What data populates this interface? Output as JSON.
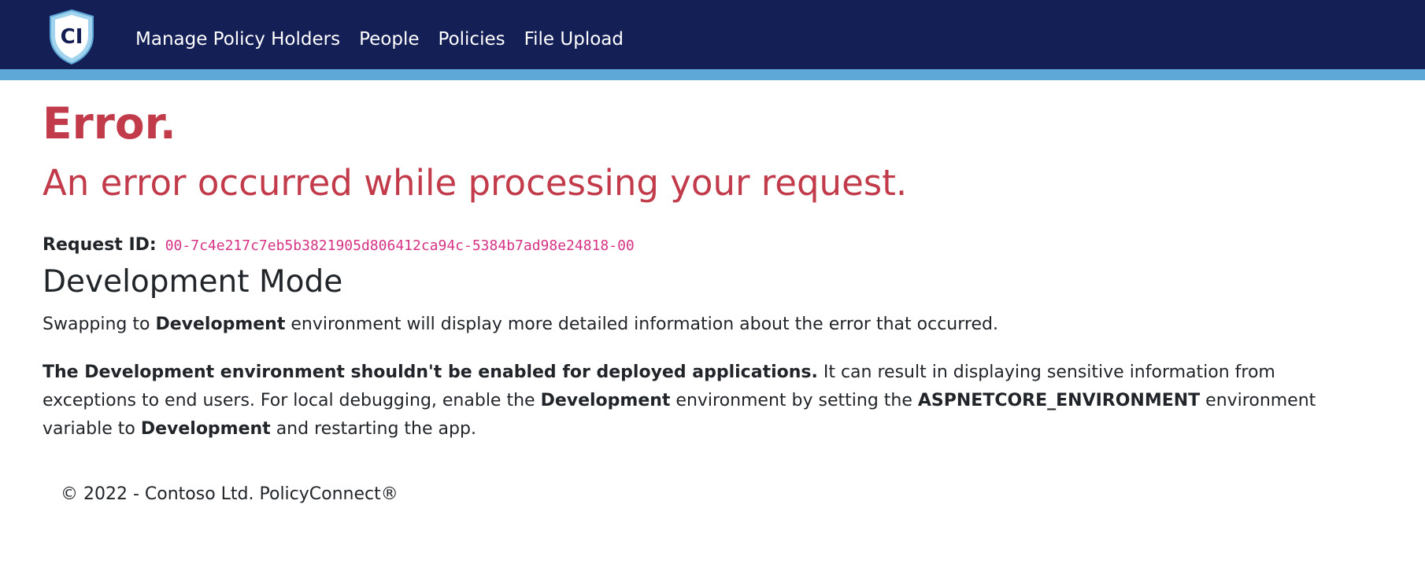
{
  "nav": {
    "logo_text": "CI",
    "links": [
      "Manage Policy Holders",
      "People",
      "Policies",
      "File Upload"
    ]
  },
  "main": {
    "title": "Error.",
    "subtitle": "An error occurred while processing your request.",
    "request_label": "Request ID:",
    "request_id": "00-7c4e217c7eb5b3821905d806412ca94c-5384b7ad98e24818-00",
    "dev_heading": "Development Mode",
    "p1": {
      "pre": "Swapping to ",
      "bold": "Development",
      "post": " environment will display more detailed information about the error that occurred."
    },
    "p2": {
      "bold1": "The Development environment shouldn't be enabled for deployed applications.",
      "text1": " It can result in displaying sensitive information from exceptions to end users. For local debugging, enable the ",
      "bold2": "Development",
      "text2": " environment by setting the ",
      "bold3": "ASPNETCORE_ENVIRONMENT",
      "text3": " environment variable to ",
      "bold4": "Development",
      "text4": " and restarting the app."
    }
  },
  "footer": {
    "text": "© 2022 - Contoso Ltd. PolicyConnect®"
  },
  "colors": {
    "navbar": "#131f55",
    "accent_bar": "#5ea8d8",
    "error": "#c23b4b",
    "code": "#d63384"
  }
}
